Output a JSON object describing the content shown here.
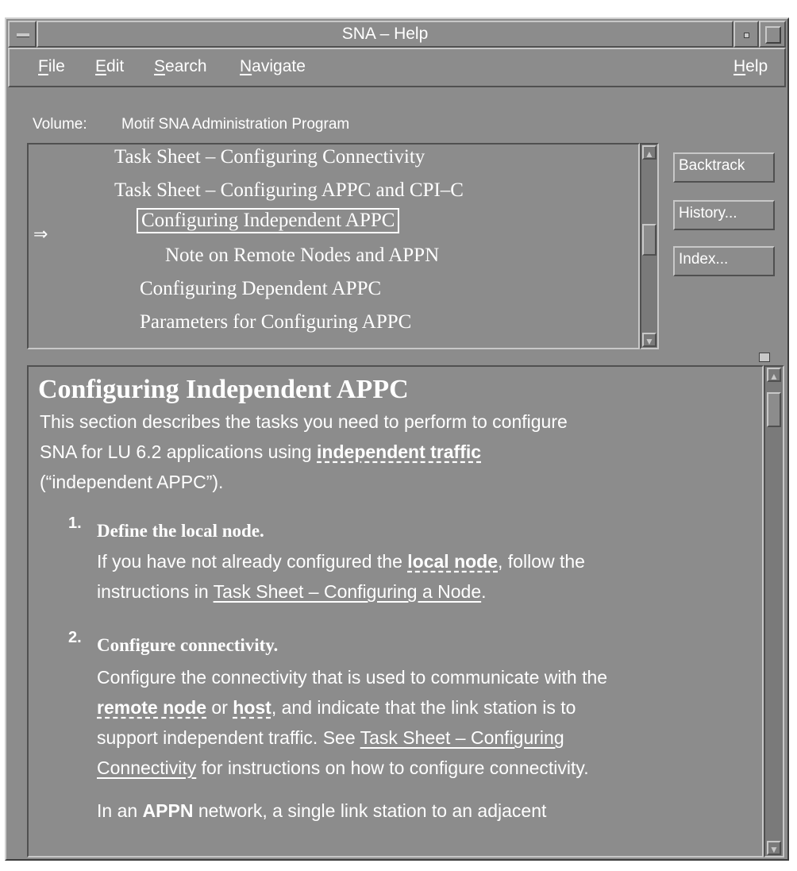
{
  "window": {
    "title": "SNA – Help"
  },
  "menubar": {
    "file": "File",
    "edit": "Edit",
    "search": "Search",
    "navigate": "Navigate",
    "help": "Help"
  },
  "volume": {
    "label": "Volume:",
    "value": "Motif SNA Administration Program"
  },
  "topics": [
    "Task Sheet – Configuring Connectivity",
    "Task Sheet – Configuring APPC and CPI–C",
    "Configuring Independent APPC",
    "Note on Remote Nodes and APPN",
    "Configuring Dependent APPC",
    "Parameters for Configuring APPC"
  ],
  "topic_arrow": "⇒",
  "selected_topic_index": 2,
  "buttons": {
    "backtrack": "Backtrack",
    "history": "History...",
    "index": "Index..."
  },
  "content": {
    "title": "Configuring Independent APPC",
    "intro": {
      "line1": "This section describes the tasks you need to perform to configure",
      "line2_pre": "SNA for LU 6.2 applications using ",
      "line2_term": "independent traffic",
      "line3": "(“independent APPC”)."
    },
    "step1": {
      "num": "1.",
      "heading": "Define the local node.",
      "l1_pre": "If you have not already configured the ",
      "l1_term": "local node",
      "l1_post": ", follow the",
      "l2_pre": "instructions in ",
      "l2_link": "Task Sheet – Configuring a Node",
      "l2_post": "."
    },
    "step2": {
      "num": "2.",
      "heading": "Configure connectivity.",
      "l1": "Configure the connectivity that is used to communicate with the",
      "l2_term1": "remote node",
      "l2_mid": " or ",
      "l2_term2": "host",
      "l2_post": ", and indicate that the link station is to",
      "l3_pre": "support independent traffic. See ",
      "l3_link": "Task Sheet – Configuring",
      "l4_link": "Connectivity",
      "l4_post": " for instructions on how to configure connectivity.",
      "l5_pre": "In an ",
      "l5_term": "APPN",
      "l5_post": " network, a single link station to an adjacent"
    }
  }
}
